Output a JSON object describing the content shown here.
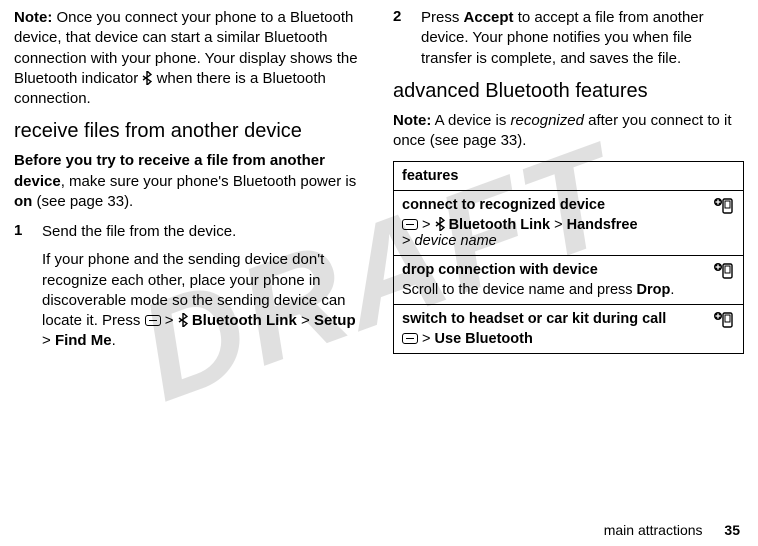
{
  "watermark": "DRAFT",
  "left": {
    "note_label": "Note:",
    "note_text": " Once you connect your phone to a Bluetooth device, that device can start a similar Bluetooth connection with your phone. Your display shows the Bluetooth indicator ",
    "note_text2": " when there is a Bluetooth connection.",
    "h_receive": "receive files from another device",
    "before_bold": "Before you try to receive a file from another device",
    "before_rest": ", make sure your phone's Bluetooth power is ",
    "on": "on",
    "before_tail": " (see page 33).",
    "step1_num": "1",
    "step1_text": "Send the file from the device.",
    "step1_sub": "If your phone and the sending device don't recognize each other, place your phone in discoverable mode so the sending device can locate it. Press ",
    "gt": ">",
    "bt_link": "Bluetooth Link",
    "setup": "Setup",
    "findme": "Find Me",
    "period": "."
  },
  "right": {
    "step2_num": "2",
    "step2_a": "Press ",
    "accept": "Accept",
    "step2_b": " to accept a file from another device. Your phone notifies you when file transfer is complete, and saves the file.",
    "h_adv": "advanced Bluetooth features",
    "note_label": "Note:",
    "note_text_a": " A device is ",
    "recognized": "recognized",
    "note_text_b": " after you connect to it once (see page 33).",
    "table": {
      "header": "features",
      "rows": [
        {
          "title": "connect to recognized device",
          "path_pre": "",
          "bt_link": "Bluetooth Link",
          "handsfree": "Handsfree",
          "device_name": "device name"
        },
        {
          "title": "drop connection with device",
          "body_a": "Scroll to the device name and press ",
          "drop": "Drop",
          "body_b": "."
        },
        {
          "title": "switch to headset or car kit during call",
          "use_bt": "Use Bluetooth"
        }
      ]
    }
  },
  "footer": {
    "section": "main attractions",
    "page": "35"
  }
}
